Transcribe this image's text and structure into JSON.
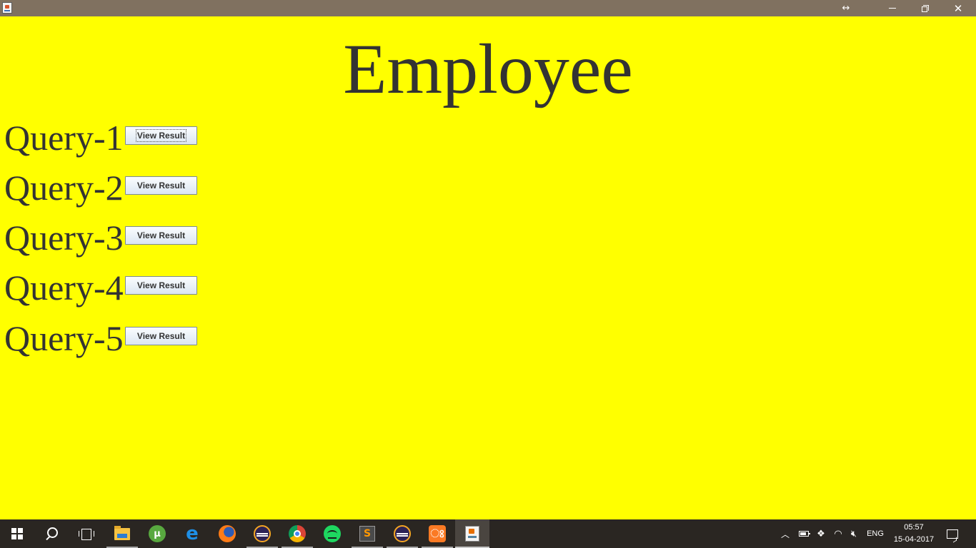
{
  "window": {
    "icon": "java-app-icon",
    "controls": {
      "resize_icon": "↔",
      "close_icon": "✕"
    }
  },
  "main": {
    "title": "Employee",
    "queries": [
      {
        "label": "Query-1",
        "button_label": "View Result",
        "focused": true
      },
      {
        "label": "Query-2",
        "button_label": "View Result",
        "focused": false
      },
      {
        "label": "Query-3",
        "button_label": "View Result",
        "focused": false
      },
      {
        "label": "Query-4",
        "button_label": "View Result",
        "focused": false
      },
      {
        "label": "Query-5",
        "button_label": "View Result",
        "focused": false
      }
    ]
  },
  "colors": {
    "background": "#ffff00",
    "text": "#333333",
    "titlebar": "#807160",
    "taskbar": "#2a2622"
  },
  "taskbar": {
    "pinned": [
      "start-button",
      "search-button",
      "task-view-button",
      "file-explorer",
      "utorrent",
      "edge",
      "firefox",
      "eclipse",
      "chrome",
      "spotify",
      "sublime-text",
      "eclipse",
      "xampp",
      "java-app"
    ],
    "tray": {
      "language": "ENG",
      "time": "05:57",
      "date": "15-04-2017"
    }
  }
}
